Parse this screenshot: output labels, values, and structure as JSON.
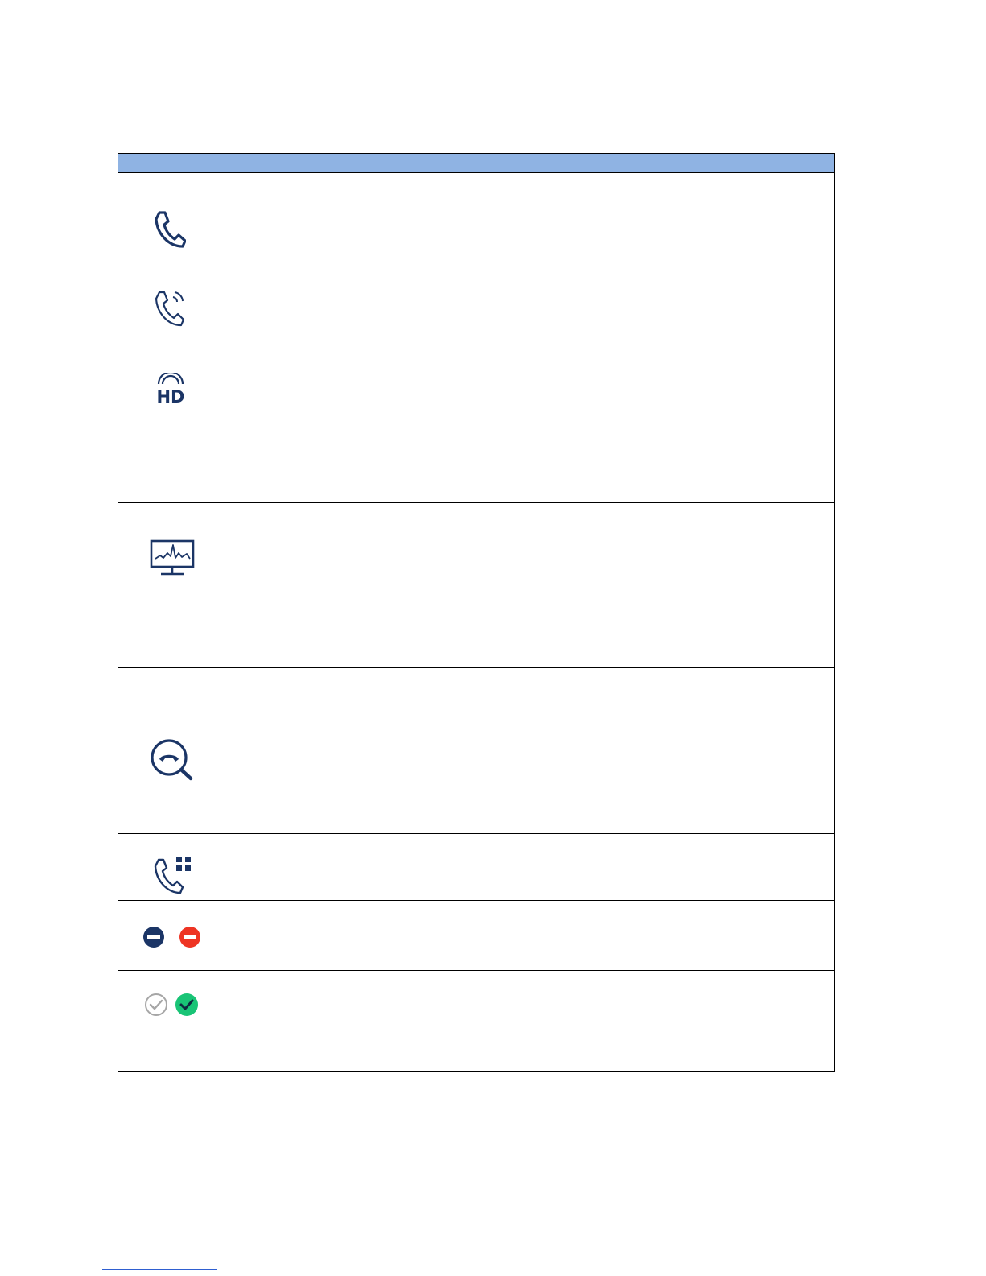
{
  "colors": {
    "header_fill": "#8fb3e3",
    "icon_navy": "#1b3566",
    "dnd_red": "#ee3423",
    "check_green": "#19c476",
    "check_gray": "#a6a6a6",
    "border": "#000000",
    "footnote_rule": "#2f5fd0"
  },
  "table": {
    "header_text": "",
    "rows": [
      {
        "icons": [
          "phone-handset-icon",
          "phone-ringing-icon",
          "hd-voice-icon"
        ]
      },
      {
        "icons": [
          "monitor-waveform-icon"
        ]
      },
      {
        "icons": [
          "call-search-icon"
        ]
      },
      {
        "icons": [
          "phone-keypad-icon"
        ]
      },
      {
        "icons": [
          "do-not-disturb-navy-icon",
          "do-not-disturb-red-icon"
        ]
      },
      {
        "icons": [
          "check-gray-icon",
          "check-green-icon"
        ]
      }
    ]
  }
}
